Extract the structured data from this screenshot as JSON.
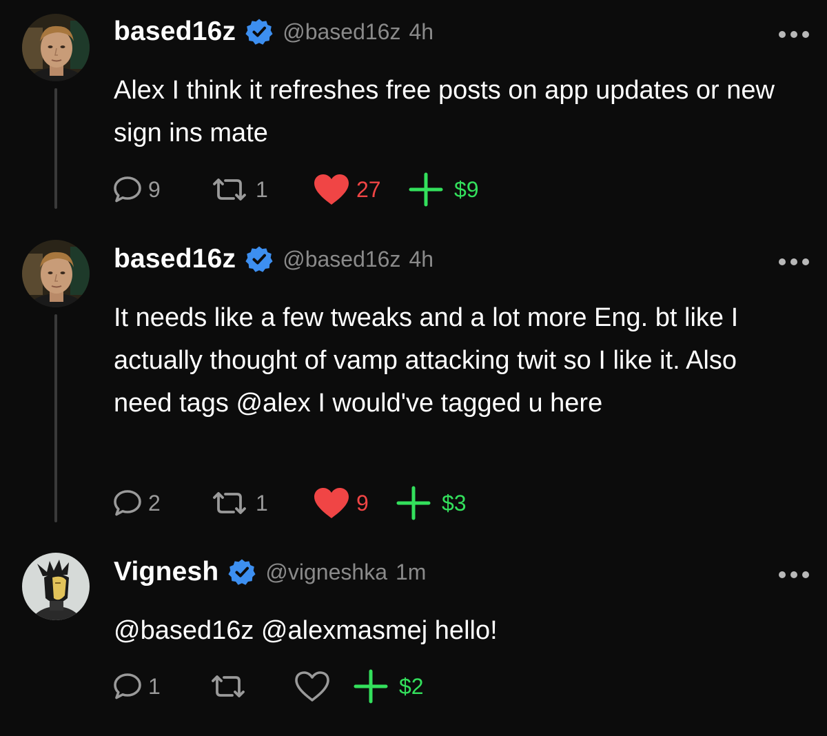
{
  "posts": [
    {
      "name": "based16z",
      "handle": "@based16z",
      "time": "4h",
      "text": "Alex I think it refreshes free posts on app updates or new sign ins mate",
      "replies": "9",
      "reposts": "1",
      "likes": "27",
      "tip": "$9",
      "liked": true
    },
    {
      "name": "based16z",
      "handle": "@based16z",
      "time": "4h",
      "text": "It needs like a few tweaks and a lot more Eng. bt like I actually thought of vamp attacking twit so I like it. Also need tags @alex I would've tagged u here",
      "replies": "2",
      "reposts": "1",
      "likes": "9",
      "tip": "$3",
      "liked": true
    },
    {
      "name": "Vignesh",
      "handle": "@vigneshka",
      "time": "1m",
      "text": "@based16z @alexmasmej hello!",
      "replies": "1",
      "reposts": "",
      "likes": "",
      "tip": "$2",
      "liked": false
    }
  ],
  "icons": {
    "verified": "verified-badge-icon",
    "reply": "reply-icon",
    "repost": "repost-icon",
    "like": "heart-icon",
    "tip": "plus-tip-icon",
    "more": "more-options-icon"
  },
  "colors": {
    "background": "#0c0c0c",
    "verified": "#3d8ff0",
    "like": "#f04545",
    "tip": "#33e05c",
    "muted": "#8a8a8a"
  }
}
